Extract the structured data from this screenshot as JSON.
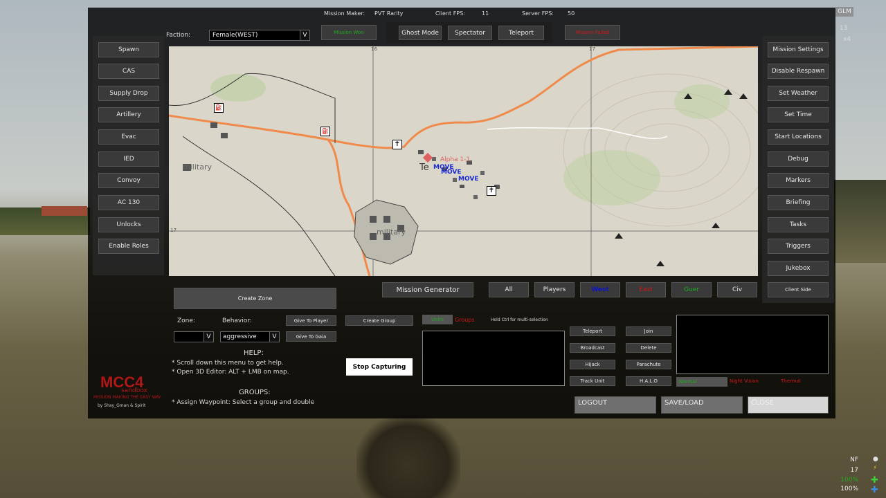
{
  "top_info": {
    "mission_maker_label": "Mission Maker:",
    "mission_maker_value": "PVT Rarity",
    "client_fps_label": "Client FPS:",
    "client_fps_value": "11",
    "server_fps_label": "Server FPS:",
    "server_fps_value": "50"
  },
  "corner_tag": "GLM",
  "corner_small": "13",
  "corner_small2": "x4",
  "faction": {
    "label": "Faction:",
    "value": "Female(WEST)"
  },
  "mission_win": "Mission Won",
  "mission_failed": "Mission Failed",
  "top_buttons": [
    "Ghost Mode",
    "Spectator",
    "Teleport"
  ],
  "left_buttons": [
    "Spawn",
    "CAS",
    "Supply Drop",
    "Artillery",
    "Evac",
    "IED",
    "Convoy",
    "AC 130",
    "Unlocks",
    "Enable Roles"
  ],
  "right_buttons": [
    "Mission Settings",
    "Disable Respawn",
    "Set Weather",
    "Set Time",
    "Start Locations",
    "Debug",
    "Markers",
    "Briefing",
    "Tasks",
    "Triggers",
    "Jukebox",
    "Client Side"
  ],
  "map_texts": {
    "town1": "military",
    "town2": "military",
    "city": "Te",
    "group_label": "Alpha 1-1",
    "move_labels": [
      "MOVE",
      "MOVE",
      "MOVE"
    ],
    "grid_top": [
      "16",
      "17"
    ],
    "grid_left": [
      "17"
    ]
  },
  "bottom_filters": {
    "generator": "Mission Generator",
    "filters": [
      "All",
      "Players",
      "West",
      "East",
      "Guer",
      "Civ"
    ],
    "colors": {
      "west": "#0a14c8",
      "east": "#d01818",
      "guer": "#1faa1f",
      "civ": "#ffffff"
    }
  },
  "zone": {
    "create_zone": "Create Zone",
    "zone_label": "Zone:",
    "behavior_label": "Behavior:",
    "behavior_value": "aggressive",
    "zone_value": "",
    "give_to_player": "Give To Player",
    "give_to_gaia": "Give To Gaia",
    "create_group": "Create Group",
    "stop_capturing": "Stop Capturing"
  },
  "help": {
    "title": "HELP:",
    "lines": [
      "* Scroll down this menu to get help.",
      "* Open 3D Editor: ALT + LMB on map."
    ],
    "groups_title": "GROUPS:",
    "groups_line": "* Assign Waypoint: Select a group and double"
  },
  "logo": {
    "title": "MCC4",
    "sub": "sandbox",
    "tagline": "MISSION MAKING THE EASY WAY",
    "by": "by Shay_Gman & Spirit"
  },
  "groups_panel": {
    "units_tab": "Units",
    "groups_tab": "Groups",
    "hint": "Hold Ctrl for multi-selection",
    "actions_left": [
      "Teleport",
      "Broadcast",
      "Hijack",
      "Track Unit"
    ],
    "actions_right": [
      "Join",
      "Delete",
      "Parachute",
      "H.A.L.O"
    ],
    "vision": [
      "Normal",
      "Night Vision",
      "Thermal"
    ]
  },
  "footer": {
    "logout": "LOGOUT",
    "save_load": "SAVE/LOAD",
    "close": "CLOSE"
  },
  "hud": {
    "nf": "NF",
    "count": "17",
    "pct1": "100%",
    "pct2": "100%"
  }
}
